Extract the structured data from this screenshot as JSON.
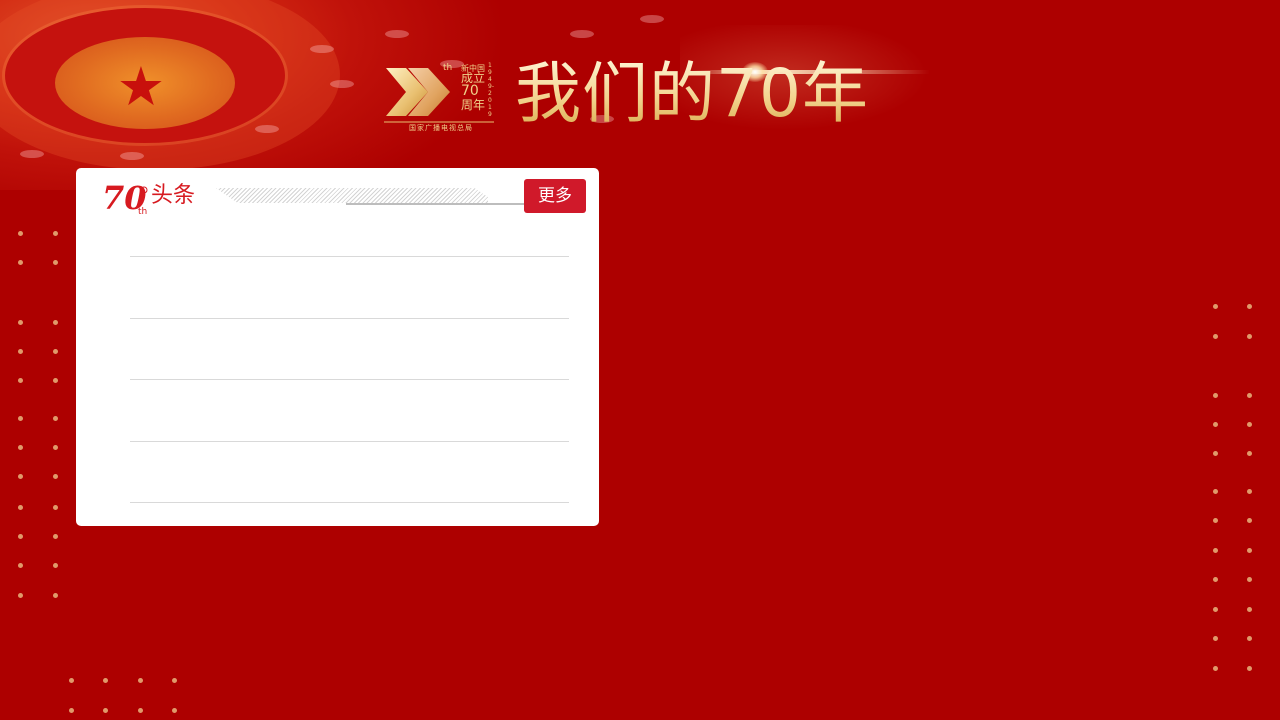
{
  "header": {
    "title": "我们的70年",
    "badge_line1": "新中国",
    "badge_line2": "成立",
    "badge_number": "70",
    "badge_line3": "周年",
    "badge_years": "1949-2019",
    "badge_ordinal": "th",
    "badge_org": "国家广播电视总局"
  },
  "panel": {
    "logo_number": "70",
    "logo_ordinal": "th",
    "title": "头条",
    "more_label": "更多",
    "items": [
      "",
      "",
      "",
      "",
      ""
    ]
  },
  "colors": {
    "background": "#ad0000",
    "accent": "#d0192a",
    "gold": "#f3d48f"
  }
}
